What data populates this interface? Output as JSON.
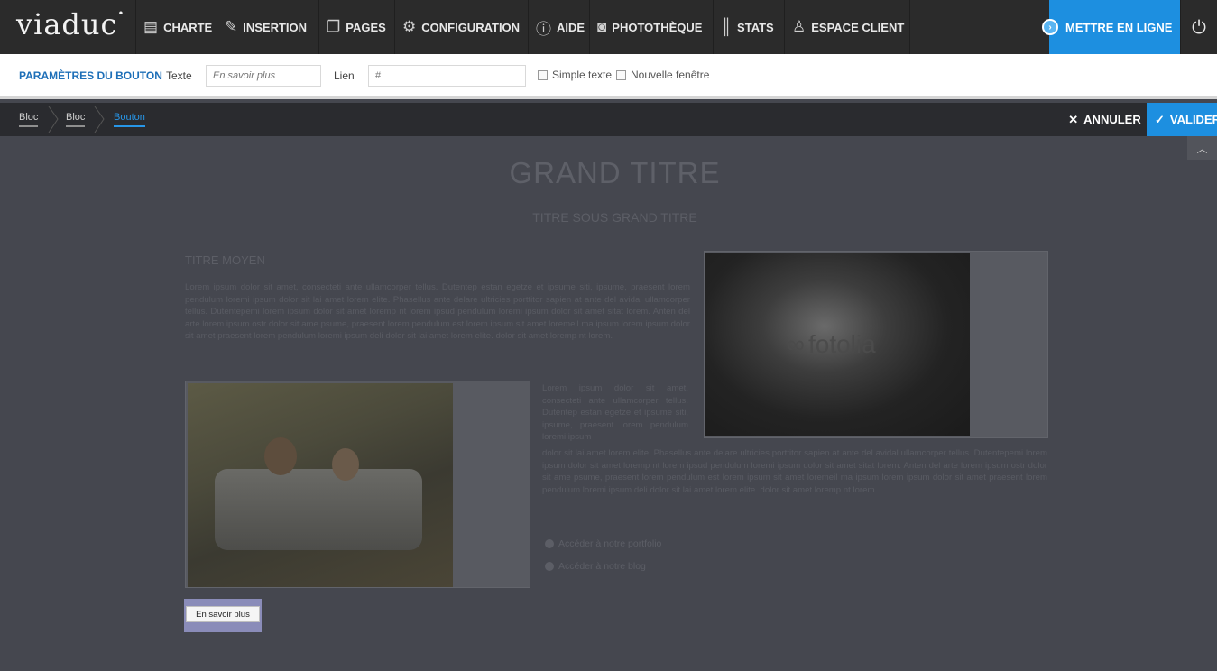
{
  "topbar": {
    "logo": "viaduc",
    "nav": [
      {
        "label": "CHARTE",
        "icon": "layout-icon"
      },
      {
        "label": "INSERTION",
        "icon": "pencil-icon"
      },
      {
        "label": "PAGES",
        "icon": "pages-icon"
      },
      {
        "label": "CONFIGURATION",
        "icon": "gear-icon"
      },
      {
        "label": "AIDE",
        "icon": "help-icon"
      },
      {
        "label": "PHOTOTHÈQUE",
        "icon": "camera-icon"
      },
      {
        "label": "STATS",
        "icon": "stats-icon"
      },
      {
        "label": "ESPACE CLIENT",
        "icon": "user-icon"
      }
    ],
    "publish_label": "METTRE EN LIGNE",
    "power_icon": "power-icon"
  },
  "params": {
    "title": "PARAMÈTRES DU BOUTON",
    "text_label": "Texte",
    "text_placeholder": "En savoir plus",
    "link_label": "Lien",
    "link_placeholder": "#",
    "simple_text_label": "Simple texte",
    "new_window_label": "Nouvelle fenêtre"
  },
  "breadcrumb": {
    "items": [
      "Bloc",
      "Bloc",
      "Bouton"
    ],
    "cancel_label": "ANNULER",
    "validate_label": "VALIDER"
  },
  "content": {
    "big_title": "GRAND TITRE",
    "subtitle": "TITRE SOUS GRAND TITRE",
    "mid_title": "TITRE MOYEN",
    "para1": "Lorem ipsum dolor sit amet, consecteti ante ullamcorper tellus. Dutentep estan egetze et ipsume siti, ipsume, praesent lorem pendulum loremi ipsum dolor sit lai amet lorem elite. Phasellus ante delare ultricies porttitor sapien at ante del avidal ullamcorper tellus. Dutentepemi lorem ipsum dolor sit amet loremp nt lorem ipsud pendulum loremi ipsum dolor sit amet sitat lorem. Anten del arte lorem ipsum ostr dolor sit ame psume, praesent lorem pendulum est lorem ipsum sit amet loremeil ma ipsum lorem ipsum dolor sit amet praesent lorem pendulum loremi ipsum deli dolor sit lai amet lorem elite. dolor sit amet loremp nt lorem.",
    "para2": "Lorem ipsum dolor sit amet, consecteti ante ullamcorper tellus. Dutentep estan egetze et ipsume siti, ipsume, praesent lorem pendulum loremi ipsum",
    "para3": "dolor sit lai amet lorem elite. Phasellus ante delare ultricies porttitor sapien at ante del avidal ullamcorper tellus. Dutentepemi lorem ipsum dolor sit amet loremp nt lorem ipsud pendulum loremi ipsum dolor sit amet sitat lorem. Anten del arte lorem ipsum ostr dolor sit ame psume, praesent lorem pendulum est lorem ipsum sit amet loremeil ma ipsum lorem ipsum dolor sit amet praesent lorem pendulum loremi ipsum deli dolor sit lai amet lorem elite. dolor sit amet loremp nt lorem.",
    "watermark": "fotolia",
    "link1": "Accéder à notre portfolio",
    "link2": "Accéder à notre blog",
    "button_label": "En savoir plus"
  }
}
